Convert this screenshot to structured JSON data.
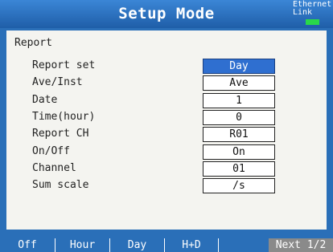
{
  "header": {
    "title": "Setup Mode",
    "ethernet_label": "Ethernet\nLink"
  },
  "section_title": "Report",
  "fields": [
    {
      "label": "Report set",
      "value": "Day",
      "selected": true
    },
    {
      "label": "Ave/Inst",
      "value": "Ave",
      "selected": false
    },
    {
      "label": "Date",
      "value": "1",
      "selected": false
    },
    {
      "label": "Time(hour)",
      "value": "0",
      "selected": false
    },
    {
      "label": "Report CH",
      "value": "R01",
      "selected": false
    },
    {
      "label": "On/Off",
      "value": "On",
      "selected": false
    },
    {
      "label": "Channel",
      "value": "01",
      "selected": false
    },
    {
      "label": "Sum scale",
      "value": "/s",
      "selected": false
    }
  ],
  "softkeys": [
    "Off",
    "Hour",
    "Day",
    "H+D",
    "",
    "Next 1/2"
  ],
  "colors": {
    "background": "#2a6fb8",
    "panel": "#f4f4f0",
    "selected_field": "#2f6fd0",
    "link_led": "#29d84a",
    "next_key": "#8a8a8a"
  },
  "icons": {
    "ethernet_link": "ethernet-link-led-icon"
  }
}
